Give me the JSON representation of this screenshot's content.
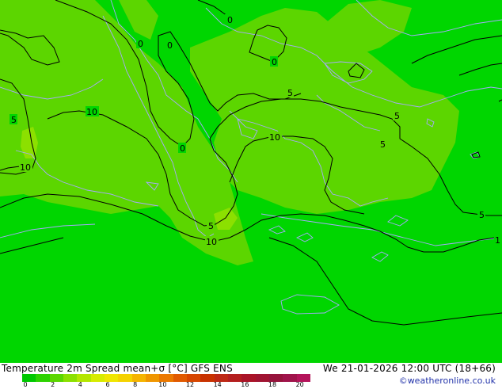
{
  "title": "Temperature 2m Spread mean+σ [°C] GFS ENS",
  "datetime": "We 21-01-2026 12:00 UTC (18+66)",
  "credit": "©weatheronline.co.uk",
  "colors": {
    "light_green": "#5cd600",
    "green": "#00d600",
    "coast": "#a8a8ff",
    "contour": "#000000"
  },
  "legend": {
    "tick_labels": [
      "0",
      "2",
      "4",
      "6",
      "8",
      "10",
      "12",
      "14",
      "16",
      "18",
      "20"
    ],
    "colors": [
      "#00c800",
      "#2dd200",
      "#5cd600",
      "#8ce000",
      "#b4e600",
      "#d7eb00",
      "#f0e600",
      "#f5d200",
      "#f5b400",
      "#f09600",
      "#eb7800",
      "#e15a00",
      "#d74600",
      "#c83200",
      "#be2814",
      "#b41e1e",
      "#aa1428",
      "#a01432",
      "#96143c",
      "#a0144b",
      "#b4145a"
    ]
  },
  "contour_labels": [
    {
      "text": "0"
    },
    {
      "text": "0"
    },
    {
      "text": "0"
    },
    {
      "text": "0"
    },
    {
      "text": "0"
    },
    {
      "text": "5"
    },
    {
      "text": "5"
    },
    {
      "text": "5"
    },
    {
      "text": "5"
    },
    {
      "text": "5"
    },
    {
      "text": "5"
    },
    {
      "text": "10"
    },
    {
      "text": "10"
    },
    {
      "text": "10"
    },
    {
      "text": "10"
    },
    {
      "text": "1"
    }
  ]
}
